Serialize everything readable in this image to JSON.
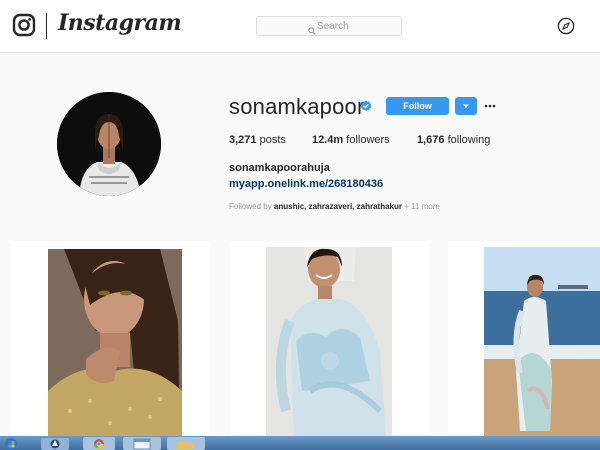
{
  "nav": {
    "logo_icon": "instagram-camera-icon",
    "wordmark": "Instagram",
    "search_placeholder": "Search",
    "search_icon": "search-icon",
    "explore_icon": "compass-icon"
  },
  "profile": {
    "username": "sonamkapoor",
    "verified_icon": "verified-badge-icon",
    "follow_label": "Follow",
    "dropdown_icon": "caret-down-icon",
    "more_icon": "more-options-icon",
    "stats": {
      "posts_count": "3,271",
      "posts_label": "posts",
      "followers_count": "12.4m",
      "followers_label": "followers",
      "following_count": "1,676",
      "following_label": "following"
    },
    "full_name": "sonamkapoorahuja",
    "link": "myapp.onelink.me/268180436",
    "followed_by": {
      "prefix": "Followed by",
      "names": "anushic, zahrazaveri, zahrathakur",
      "more": "+ 11 more"
    }
  },
  "colors": {
    "accent": "#3897f0",
    "link": "#003569",
    "muted": "#999999"
  },
  "posts": [
    {
      "icon": "photo-thumbnail"
    },
    {
      "icon": "photo-thumbnail"
    },
    {
      "icon": "photo-thumbnail"
    }
  ],
  "taskbar": {
    "items": [
      "start-orb-icon",
      "app-icon",
      "chrome-icon",
      "window-icon",
      "folder-icon"
    ]
  }
}
